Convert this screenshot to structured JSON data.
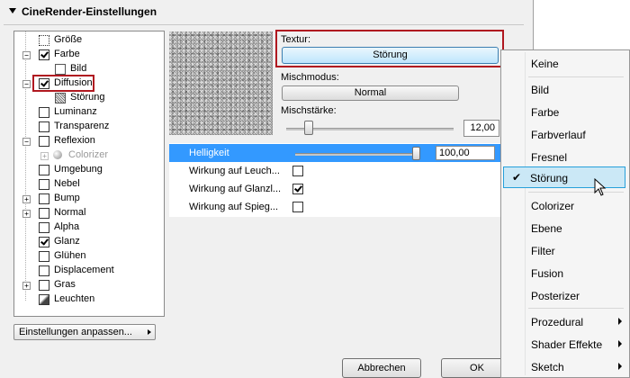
{
  "header": {
    "title": "CineRender-Einstellungen"
  },
  "tree": {
    "items": [
      {
        "label": "Größe",
        "checkbox": "size-icon",
        "checked": false
      },
      {
        "label": "Farbe",
        "checked": true,
        "expanded": true
      },
      {
        "label": "Bild",
        "sub": true
      },
      {
        "label": "Diffusion",
        "checked": true,
        "expanded": true,
        "highlighted": true
      },
      {
        "label": "Störung",
        "sub": true
      },
      {
        "label": "Luminanz",
        "checked": false
      },
      {
        "label": "Transparenz",
        "checked": false
      },
      {
        "label": "Reflexion",
        "checked": false,
        "expandable": true
      },
      {
        "label": "Colorizer",
        "sub": true,
        "disabled": true
      },
      {
        "label": "Umgebung",
        "checked": false
      },
      {
        "label": "Nebel",
        "checked": false
      },
      {
        "label": "Bump",
        "checked": false,
        "expandable": true
      },
      {
        "label": "Normal",
        "checked": false,
        "expandable": true
      },
      {
        "label": "Alpha",
        "checked": false
      },
      {
        "label": "Glanz",
        "checked": true
      },
      {
        "label": "Glühen",
        "checked": false
      },
      {
        "label": "Displacement",
        "checked": false
      },
      {
        "label": "Gras",
        "checked": false,
        "expandable": true
      },
      {
        "label": "Leuchten",
        "checked": false
      }
    ]
  },
  "adjust_button": {
    "label": "Einstellungen anpassen..."
  },
  "texture": {
    "label": "Textur:",
    "value": "Störung"
  },
  "mix": {
    "label": "Mischmodus:",
    "value": "Normal"
  },
  "strength": {
    "label": "Mischstärke:",
    "value": "12,00",
    "fraction": 0.12
  },
  "properties": [
    {
      "name": "Helligkeit",
      "value": "100,00",
      "selected": true,
      "level": 1.0
    },
    {
      "name": "Wirkung auf Leuch...",
      "checked": false
    },
    {
      "name": "Wirkung auf Glanzl...",
      "checked": true
    },
    {
      "name": "Wirkung auf Spieg...",
      "checked": false
    }
  ],
  "buttons": {
    "cancel": "Abbrechen",
    "ok": "OK"
  },
  "menu": {
    "items": [
      {
        "label": "Keine"
      },
      {
        "label": "Bild"
      },
      {
        "label": "Farbe"
      },
      {
        "label": "Farbverlauf"
      },
      {
        "label": "Fresnel"
      },
      {
        "label": "Störung",
        "checked": true,
        "selected": true
      },
      {
        "label": "Colorizer"
      },
      {
        "label": "Ebene"
      },
      {
        "label": "Filter"
      },
      {
        "label": "Fusion"
      },
      {
        "label": "Posterizer"
      },
      {
        "label": "Prozedural",
        "submenu": true
      },
      {
        "label": "Shader Effekte",
        "submenu": true
      },
      {
        "label": "Sketch",
        "submenu": true
      }
    ],
    "check_glyph": "✔"
  },
  "colors": {
    "selection": "#3399ff",
    "highlight_frame": "#b01820",
    "menu_hover": "#cbe8f6"
  }
}
